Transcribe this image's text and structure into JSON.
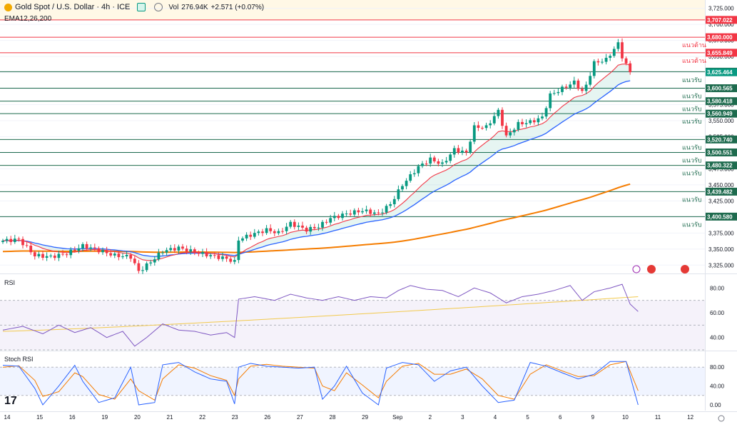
{
  "header": {
    "symbol": "Gold Spot / U.S. Dollar · 4h · ICE",
    "vol_label": "Vol",
    "vol_value": "276.94K",
    "change": "+2.571 (+0.07%)",
    "indicator": "EMA12,26,200"
  },
  "colors": {
    "up": "#089981",
    "down": "#f23645",
    "resistance": "#f23645",
    "support": "#1e6b4e",
    "ema12": "#f23645",
    "ema26": "#2962ff",
    "ema200": "#f57c00",
    "rsi": "#7e57c2",
    "stoch_k": "#2962ff",
    "stoch_d": "#f57c00"
  },
  "price_axis": {
    "ticks": [
      "3,725.000",
      "3,700.000",
      "3,675.000",
      "3,650.000",
      "3,625.000",
      "3,600.000",
      "3,575.000",
      "3,550.000",
      "3,525.000",
      "3,500.000",
      "3,475.000",
      "3,450.000",
      "3,425.000",
      "3,400.000",
      "3,375.000",
      "3,350.000",
      "3,325.000"
    ]
  },
  "levels": [
    {
      "price": 3707.022,
      "label": "3,707.022",
      "kind": "resistance",
      "tag": ""
    },
    {
      "price": 3680.0,
      "label": "3,680.000",
      "kind": "resistance",
      "tag": "แนวต้าน"
    },
    {
      "price": 3655.849,
      "label": "3,655.849",
      "kind": "resistance",
      "tag": "แนวต้าน"
    },
    {
      "price": 3626.33,
      "label": "3,626.330",
      "kind": "support",
      "tag": ""
    },
    {
      "price": 3625.464,
      "label": "3,625.464",
      "kind": "current",
      "tag": "แนวรับ"
    },
    {
      "price": 3600.565,
      "label": "3,600.565",
      "kind": "support",
      "tag": "แนวรับ"
    },
    {
      "price": 3580.418,
      "label": "3,580.418",
      "kind": "support",
      "tag": "แนวรับ"
    },
    {
      "price": 3560.949,
      "label": "3,560.949",
      "kind": "support",
      "tag": "แนวรับ"
    },
    {
      "price": 3520.74,
      "label": "3,520.740",
      "kind": "support",
      "tag": "แนวรับ"
    },
    {
      "price": 3500.551,
      "label": "3,500.551",
      "kind": "support",
      "tag": "แนวรับ"
    },
    {
      "price": 3480.322,
      "label": "3,480.322",
      "kind": "support",
      "tag": "แนวรับ"
    },
    {
      "price": 3439.482,
      "label": "3,439.482",
      "kind": "support",
      "tag": "แนวรับ"
    },
    {
      "price": 3400.58,
      "label": "3,400.580",
      "kind": "support",
      "tag": "แนวรับ"
    }
  ],
  "x_axis": {
    "labels": [
      "14",
      "15",
      "16",
      "19",
      "20",
      "21",
      "22",
      "23",
      "26",
      "27",
      "28",
      "29",
      "Sep",
      "2",
      "3",
      "4",
      "5",
      "6",
      "9",
      "10",
      "11",
      "12"
    ]
  },
  "rsi_panel": {
    "title": "RSI",
    "ticks": [
      "80.00",
      "60.00",
      "40.00"
    ]
  },
  "stoch_panel": {
    "title": "Stoch RSI",
    "ticks": [
      "80.00",
      "40.00",
      "0.00"
    ]
  },
  "chart_data": {
    "type": "candlestick",
    "title": "Gold Spot / U.S. Dollar · 4h · ICE",
    "ylim": [
      3312,
      3738
    ],
    "anchors": [
      [
        0,
        3363
      ],
      [
        4,
        3365
      ],
      [
        8,
        3340
      ],
      [
        12,
        3338
      ],
      [
        16,
        3343
      ],
      [
        20,
        3355
      ],
      [
        24,
        3348
      ],
      [
        28,
        3340
      ],
      [
        32,
        3338
      ],
      [
        34,
        3315
      ],
      [
        37,
        3330
      ],
      [
        40,
        3347
      ],
      [
        44,
        3352
      ],
      [
        48,
        3345
      ],
      [
        52,
        3340
      ],
      [
        56,
        3335
      ],
      [
        58,
        3330
      ],
      [
        59,
        3365
      ],
      [
        62,
        3372
      ],
      [
        66,
        3380
      ],
      [
        69,
        3375
      ],
      [
        72,
        3390
      ],
      [
        76,
        3380
      ],
      [
        79,
        3385
      ],
      [
        82,
        3398
      ],
      [
        86,
        3405
      ],
      [
        90,
        3410
      ],
      [
        94,
        3405
      ],
      [
        97,
        3420
      ],
      [
        100,
        3450
      ],
      [
        104,
        3478
      ],
      [
        107,
        3490
      ],
      [
        110,
        3482
      ],
      [
        113,
        3505
      ],
      [
        116,
        3500
      ],
      [
        118,
        3540
      ],
      [
        121,
        3540
      ],
      [
        124,
        3565
      ],
      [
        126,
        3525
      ],
      [
        129,
        3545
      ],
      [
        132,
        3548
      ],
      [
        135,
        3555
      ],
      [
        137,
        3590
      ],
      [
        140,
        3600
      ],
      [
        143,
        3610
      ],
      [
        145,
        3595
      ],
      [
        146,
        3605
      ],
      [
        148,
        3640
      ],
      [
        151,
        3645
      ],
      [
        154,
        3670
      ],
      [
        155,
        3650
      ],
      [
        157,
        3625
      ]
    ],
    "rsi": [
      [
        0,
        46
      ],
      [
        5,
        49
      ],
      [
        10,
        43
      ],
      [
        14,
        50
      ],
      [
        18,
        44
      ],
      [
        22,
        48
      ],
      [
        26,
        40
      ],
      [
        30,
        45
      ],
      [
        33,
        33
      ],
      [
        36,
        40
      ],
      [
        40,
        51
      ],
      [
        44,
        46
      ],
      [
        48,
        45
      ],
      [
        52,
        42
      ],
      [
        56,
        44
      ],
      [
        58,
        40
      ],
      [
        59,
        71
      ],
      [
        63,
        73
      ],
      [
        68,
        70
      ],
      [
        72,
        75
      ],
      [
        76,
        72
      ],
      [
        80,
        70
      ],
      [
        84,
        73
      ],
      [
        88,
        70
      ],
      [
        92,
        73
      ],
      [
        96,
        72
      ],
      [
        99,
        78
      ],
      [
        102,
        82
      ],
      [
        106,
        79
      ],
      [
        110,
        78
      ],
      [
        114,
        73
      ],
      [
        118,
        80
      ],
      [
        122,
        76
      ],
      [
        126,
        68
      ],
      [
        130,
        73
      ],
      [
        134,
        75
      ],
      [
        138,
        78
      ],
      [
        142,
        82
      ],
      [
        145,
        70
      ],
      [
        148,
        77
      ],
      [
        152,
        80
      ],
      [
        155,
        83
      ],
      [
        157,
        67
      ],
      [
        159,
        61
      ]
    ],
    "stoch_k": [
      [
        0,
        84
      ],
      [
        4,
        82
      ],
      [
        8,
        35
      ],
      [
        10,
        0
      ],
      [
        14,
        40
      ],
      [
        18,
        84
      ],
      [
        20,
        50
      ],
      [
        24,
        5
      ],
      [
        28,
        15
      ],
      [
        32,
        80
      ],
      [
        34,
        0
      ],
      [
        38,
        5
      ],
      [
        40,
        85
      ],
      [
        44,
        90
      ],
      [
        48,
        70
      ],
      [
        52,
        55
      ],
      [
        56,
        50
      ],
      [
        58,
        2
      ],
      [
        59,
        80
      ],
      [
        62,
        88
      ],
      [
        66,
        82
      ],
      [
        70,
        80
      ],
      [
        74,
        78
      ],
      [
        78,
        80
      ],
      [
        80,
        12
      ],
      [
        83,
        40
      ],
      [
        86,
        82
      ],
      [
        90,
        25
      ],
      [
        94,
        0
      ],
      [
        96,
        78
      ],
      [
        100,
        90
      ],
      [
        104,
        85
      ],
      [
        108,
        50
      ],
      [
        112,
        72
      ],
      [
        116,
        80
      ],
      [
        120,
        40
      ],
      [
        124,
        5
      ],
      [
        128,
        10
      ],
      [
        132,
        90
      ],
      [
        136,
        82
      ],
      [
        140,
        68
      ],
      [
        144,
        55
      ],
      [
        148,
        65
      ],
      [
        152,
        92
      ],
      [
        156,
        92
      ],
      [
        159,
        0
      ]
    ],
    "stoch_d": [
      [
        0,
        80
      ],
      [
        4,
        83
      ],
      [
        8,
        52
      ],
      [
        10,
        18
      ],
      [
        14,
        28
      ],
      [
        18,
        68
      ],
      [
        20,
        60
      ],
      [
        24,
        22
      ],
      [
        28,
        12
      ],
      [
        32,
        55
      ],
      [
        34,
        30
      ],
      [
        38,
        10
      ],
      [
        40,
        55
      ],
      [
        44,
        85
      ],
      [
        48,
        78
      ],
      [
        52,
        62
      ],
      [
        56,
        52
      ],
      [
        58,
        20
      ],
      [
        59,
        55
      ],
      [
        62,
        82
      ],
      [
        66,
        86
      ],
      [
        70,
        82
      ],
      [
        74,
        80
      ],
      [
        78,
        78
      ],
      [
        80,
        40
      ],
      [
        83,
        30
      ],
      [
        86,
        68
      ],
      [
        90,
        42
      ],
      [
        94,
        15
      ],
      [
        96,
        50
      ],
      [
        100,
        82
      ],
      [
        104,
        88
      ],
      [
        108,
        65
      ],
      [
        112,
        65
      ],
      [
        116,
        76
      ],
      [
        120,
        55
      ],
      [
        124,
        20
      ],
      [
        128,
        12
      ],
      [
        132,
        65
      ],
      [
        136,
        85
      ],
      [
        140,
        72
      ],
      [
        144,
        60
      ],
      [
        148,
        62
      ],
      [
        152,
        85
      ],
      [
        156,
        92
      ],
      [
        159,
        30
      ]
    ],
    "rsi_ma_start": 45,
    "rsi_ma_end": 73
  }
}
